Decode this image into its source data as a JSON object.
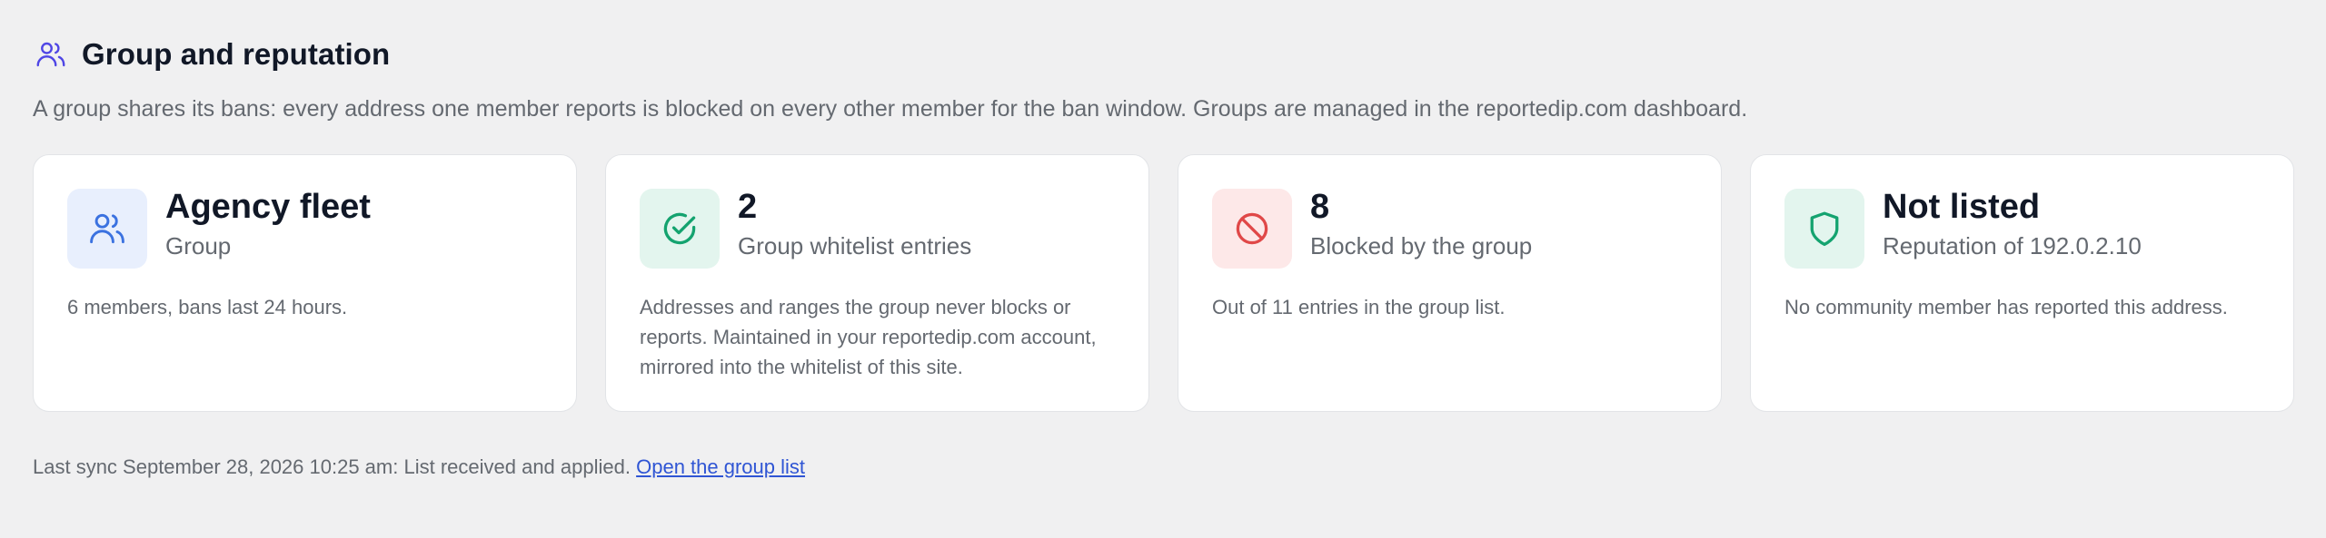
{
  "section": {
    "title": "Group and reputation",
    "icon": "users-icon",
    "description": "A group shares its bans: every address one member reports is blocked on every other member for the ban window. Groups are managed in the reportedip.com dashboard."
  },
  "cards": [
    {
      "icon": "users-icon",
      "color": "#3b72e0",
      "value": "Agency fleet",
      "label": "Group",
      "note": "6 members, bans last 24 hours."
    },
    {
      "icon": "check-circle-icon",
      "color": "#14a36f",
      "value": "2",
      "label": "Group whitelist entries",
      "note": "Addresses and ranges the group never blocks or reports. Maintained in your reportedip.com account, mirrored into the whitelist of this site."
    },
    {
      "icon": "ban-icon",
      "color": "#e04848",
      "value": "8",
      "label": "Blocked by the group",
      "note": "Out of 11 entries in the group list."
    },
    {
      "icon": "shield-icon",
      "color": "#14a36f",
      "value": "Not listed",
      "label": "Reputation of 192.0.2.10",
      "note": "No community member has reported this address."
    }
  ],
  "footer": {
    "sync_text": "Last sync September 28, 2026 10:25 am: List received and applied.",
    "link_label": "Open the group list"
  }
}
